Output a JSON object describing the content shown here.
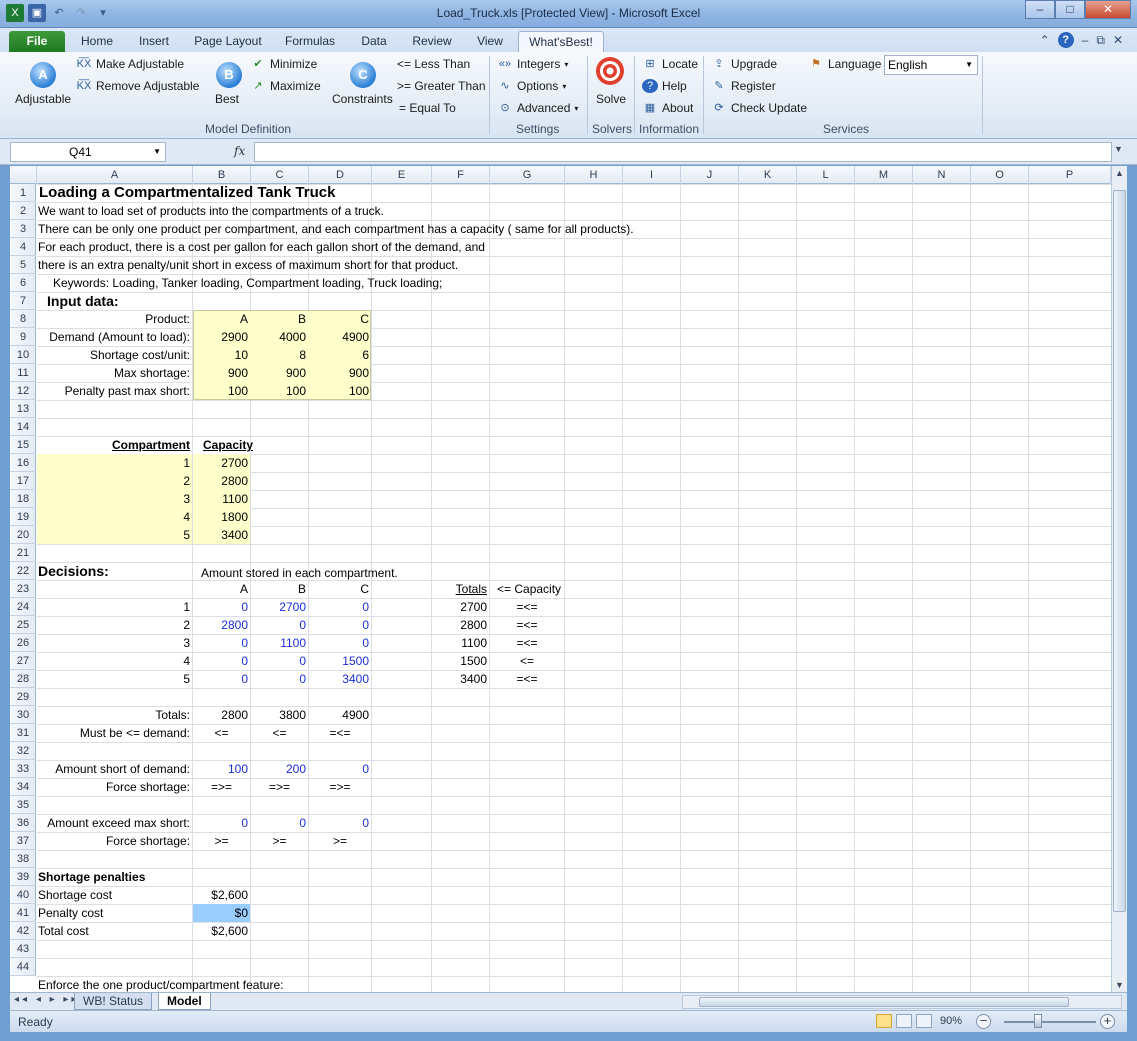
{
  "window": {
    "title": "Load_Truck.xls  [Protected View]  -  Microsoft Excel",
    "minimize": "–",
    "maximize": "□",
    "close": "✕"
  },
  "ribbon_tabs": [
    "File",
    "Home",
    "Insert",
    "Page Layout",
    "Formulas",
    "Data",
    "Review",
    "View",
    "What'sBest!"
  ],
  "ribbon": {
    "adjustable": "Adjustable",
    "make_adjustable": "Make Adjustable",
    "remove_adjustable": "Remove Adjustable",
    "best": "Best",
    "minimize": "Minimize",
    "maximize": "Maximize",
    "constraints": "Constraints",
    "less_than": "<= Less Than",
    "greater_than": ">= Greater Than",
    "equal_to": "= Equal To",
    "integers": "Integers",
    "options": "Options",
    "advanced": "Advanced",
    "solve": "Solve",
    "locate": "Locate",
    "help": "Help",
    "about": "About",
    "upgrade": "Upgrade",
    "register": "Register",
    "check_update": "Check Update",
    "language": "Language",
    "language_value": "English",
    "groups": {
      "model_definition": "Model Definition",
      "settings": "Settings",
      "solvers": "Solvers",
      "information": "Information",
      "services": "Services"
    }
  },
  "formula_bar": {
    "name_box": "Q41",
    "fx": "fx",
    "formula": ""
  },
  "columns": [
    "A",
    "B",
    "C",
    "D",
    "E",
    "F",
    "G",
    "H",
    "I",
    "J",
    "K",
    "L",
    "M",
    "N",
    "O",
    "P"
  ],
  "rows": [
    "1",
    "2",
    "3",
    "4",
    "5",
    "6",
    "7",
    "8",
    "9",
    "10",
    "11",
    "12",
    "13",
    "14",
    "15",
    "16",
    "17",
    "18",
    "19",
    "20",
    "21",
    "22",
    "23",
    "24",
    "25",
    "26",
    "27",
    "28",
    "29",
    "30",
    "31",
    "32",
    "33",
    "34",
    "35",
    "36",
    "37",
    "38",
    "39",
    "40",
    "41",
    "42",
    "43",
    "44"
  ],
  "sheet": {
    "title": "Loading a Compartmentalized Tank Truck",
    "desc1": "We want to load set of products into the compartments of a truck.",
    "desc2": "There can be only one product per compartment, and each compartment has a capacity ( same for all products).",
    "desc3": "For each product, there is a cost per gallon for each gallon short of the demand, and",
    "desc4": " there is an extra penalty/unit short in excess of maximum short for that product.",
    "keywords": "Keywords: Loading, Tanker loading, Compartment loading, Truck loading;",
    "input_data": "Input data:",
    "input_labels": [
      "Product:",
      "Demand (Amount to load):",
      "Shortage cost/unit:",
      "Max shortage:",
      "Penalty past max short:"
    ],
    "input_values": [
      [
        "A",
        "B",
        "C"
      ],
      [
        "2900",
        "4000",
        "4900"
      ],
      [
        "10",
        "8",
        "6"
      ],
      [
        "900",
        "900",
        "900"
      ],
      [
        "100",
        "100",
        "100"
      ]
    ],
    "compartment_header": "Compartment",
    "capacity_header": "Capacity",
    "compartments": [
      "1",
      "2",
      "3",
      "4",
      "5"
    ],
    "capacities": [
      "2700",
      "2800",
      "1100",
      "1800",
      "3400"
    ],
    "decisions": "Decisions:",
    "decisions_note": "Amount stored in each compartment.",
    "decision_cols": [
      "A",
      "B",
      "C"
    ],
    "totals_header": "Totals",
    "cap_header": "<= Capacity",
    "decision_rows": [
      {
        "idx": "1",
        "vals": [
          "0",
          "2700",
          "0"
        ],
        "total": "2700",
        "rel": "=<="
      },
      {
        "idx": "2",
        "vals": [
          "2800",
          "0",
          "0"
        ],
        "total": "2800",
        "rel": "=<="
      },
      {
        "idx": "3",
        "vals": [
          "0",
          "1100",
          "0"
        ],
        "total": "1100",
        "rel": "=<="
      },
      {
        "idx": "4",
        "vals": [
          "0",
          "0",
          "1500"
        ],
        "total": "1500",
        "rel": "<="
      },
      {
        "idx": "5",
        "vals": [
          "0",
          "0",
          "3400"
        ],
        "total": "3400",
        "rel": "=<="
      }
    ],
    "totals_label": "Totals:",
    "totals_vals": [
      "2800",
      "3800",
      "4900"
    ],
    "must_label": "Must be <= demand:",
    "must_vals": [
      "<=",
      "<=",
      "=<="
    ],
    "short_label": "Amount short of demand:",
    "short_vals": [
      "100",
      "200",
      "0"
    ],
    "force1_label": "Force shortage:",
    "force1_vals": [
      "=>=",
      "=>=",
      "=>="
    ],
    "exceed_label": "Amount exceed max short:",
    "exceed_vals": [
      "0",
      "0",
      "0"
    ],
    "force2_label": "Force shortage:",
    "force2_vals": [
      ">=",
      ">=",
      ">="
    ],
    "penalties_header": "Shortage penalties",
    "shortage_cost_label": "Shortage cost",
    "shortage_cost": "$2,600",
    "penalty_cost_label": "Penalty cost",
    "penalty_cost": "$0",
    "total_cost_label": "Total cost",
    "total_cost": "$2,600",
    "enforce": "Enforce the one product/compartment feature:"
  },
  "sheet_tabs": [
    "WB! Status",
    "Model"
  ],
  "status": {
    "ready": "Ready",
    "zoom": "90%"
  },
  "colors": {
    "input_fill": "#ffffcc",
    "selected_fill": "#99ccff",
    "adjustable_text": "#1a2fd8"
  }
}
